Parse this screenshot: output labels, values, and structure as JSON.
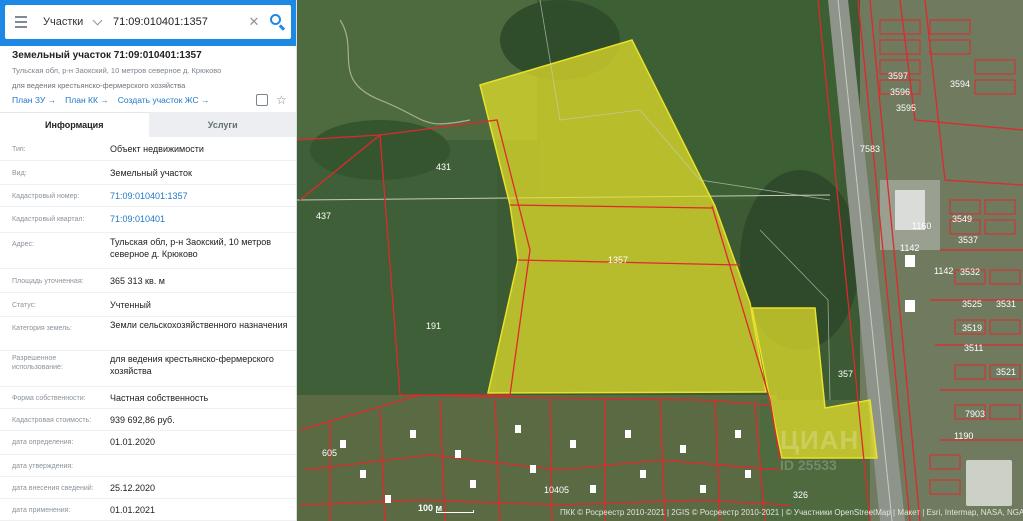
{
  "search": {
    "layer": "Участки",
    "query": "71:09:010401:1357",
    "clear_symbol": "✕"
  },
  "parcel": {
    "title": "Земельный участок 71:09:010401:1357",
    "address": "Тульская обл, р-н Заокский, 10 метров северное д. Крюково",
    "purpose": "для ведения крестьянско-фермерского хозяйства"
  },
  "links": {
    "plan_zu": "План ЗУ →",
    "plan_kk": "План КК →",
    "create_zhs": "Создать участок ЖС →"
  },
  "tabs": {
    "info": "Информация",
    "services": "Услуги"
  },
  "fields": [
    {
      "label": "Тип:",
      "value": "Объект недвижимости"
    },
    {
      "label": "Вид:",
      "value": "Земельный участок"
    },
    {
      "label": "Кадастровый номер:",
      "value": "71:09:010401:1357"
    },
    {
      "label": "Кадастровый квартал:",
      "value": "71:09:010401"
    },
    {
      "label": "Адрес:",
      "value": "Тульская обл, р-н Заокский, 10 метров северное д. Крюково"
    },
    {
      "label": "Площадь уточненная:",
      "value": "365 313 кв. м"
    },
    {
      "label": "Статус:",
      "value": "Учтенный"
    },
    {
      "label": "Категория земель:",
      "value": "Земли сельскохозяйственного назначения"
    },
    {
      "label": "Разрешенное использование:",
      "value": "для ведения крестьянско-фермерского хозяйства"
    },
    {
      "label": "Форма собственности:",
      "value": "Частная собственность"
    },
    {
      "label": "Кадастровая стоимость:",
      "value": "939 692,86 руб."
    },
    {
      "label": "дата определения:",
      "value": "01.01.2020"
    },
    {
      "label": "дата утверждения:",
      "value": ""
    },
    {
      "label": "дата внесения сведений:",
      "value": "25.12.2020"
    },
    {
      "label": "дата применения:",
      "value": "01.01.2021"
    }
  ],
  "map": {
    "labels": {
      "parcel": "1357",
      "p431": "431",
      "p437": "437",
      "p191": "191",
      "p357": "357",
      "p1142": "1142",
      "p1160": "1160",
      "p1142b": "1142",
      "p7903": "7903",
      "p1190": "1190",
      "p7583": "7583",
      "p10405": "10405",
      "p605": "605",
      "p326": "326",
      "p3597": "3597",
      "p3596": "3596",
      "p3595": "3595",
      "p3594": "3594",
      "p3549": "3549",
      "p3537": "3537",
      "p3532": "3532",
      "p3525": "3525",
      "p3531": "3531",
      "p3519": "3519",
      "p3511": "3511",
      "p3521": "3521"
    },
    "scale": "100 м",
    "attribution": "ПКК © Росреестр 2010-2021 | 2GIS © Росреестр 2010-2021 | © Участники OpenStreetMap | Макет | Esri, Intermap, NASA, NGA, USGS",
    "watermark": "ЦИАН",
    "watermark_id": "ID 25533",
    "colors": {
      "parcel_fill": "#e8e22a",
      "boundary": "#e0282e",
      "panel_accent": "#1e88e5"
    }
  }
}
